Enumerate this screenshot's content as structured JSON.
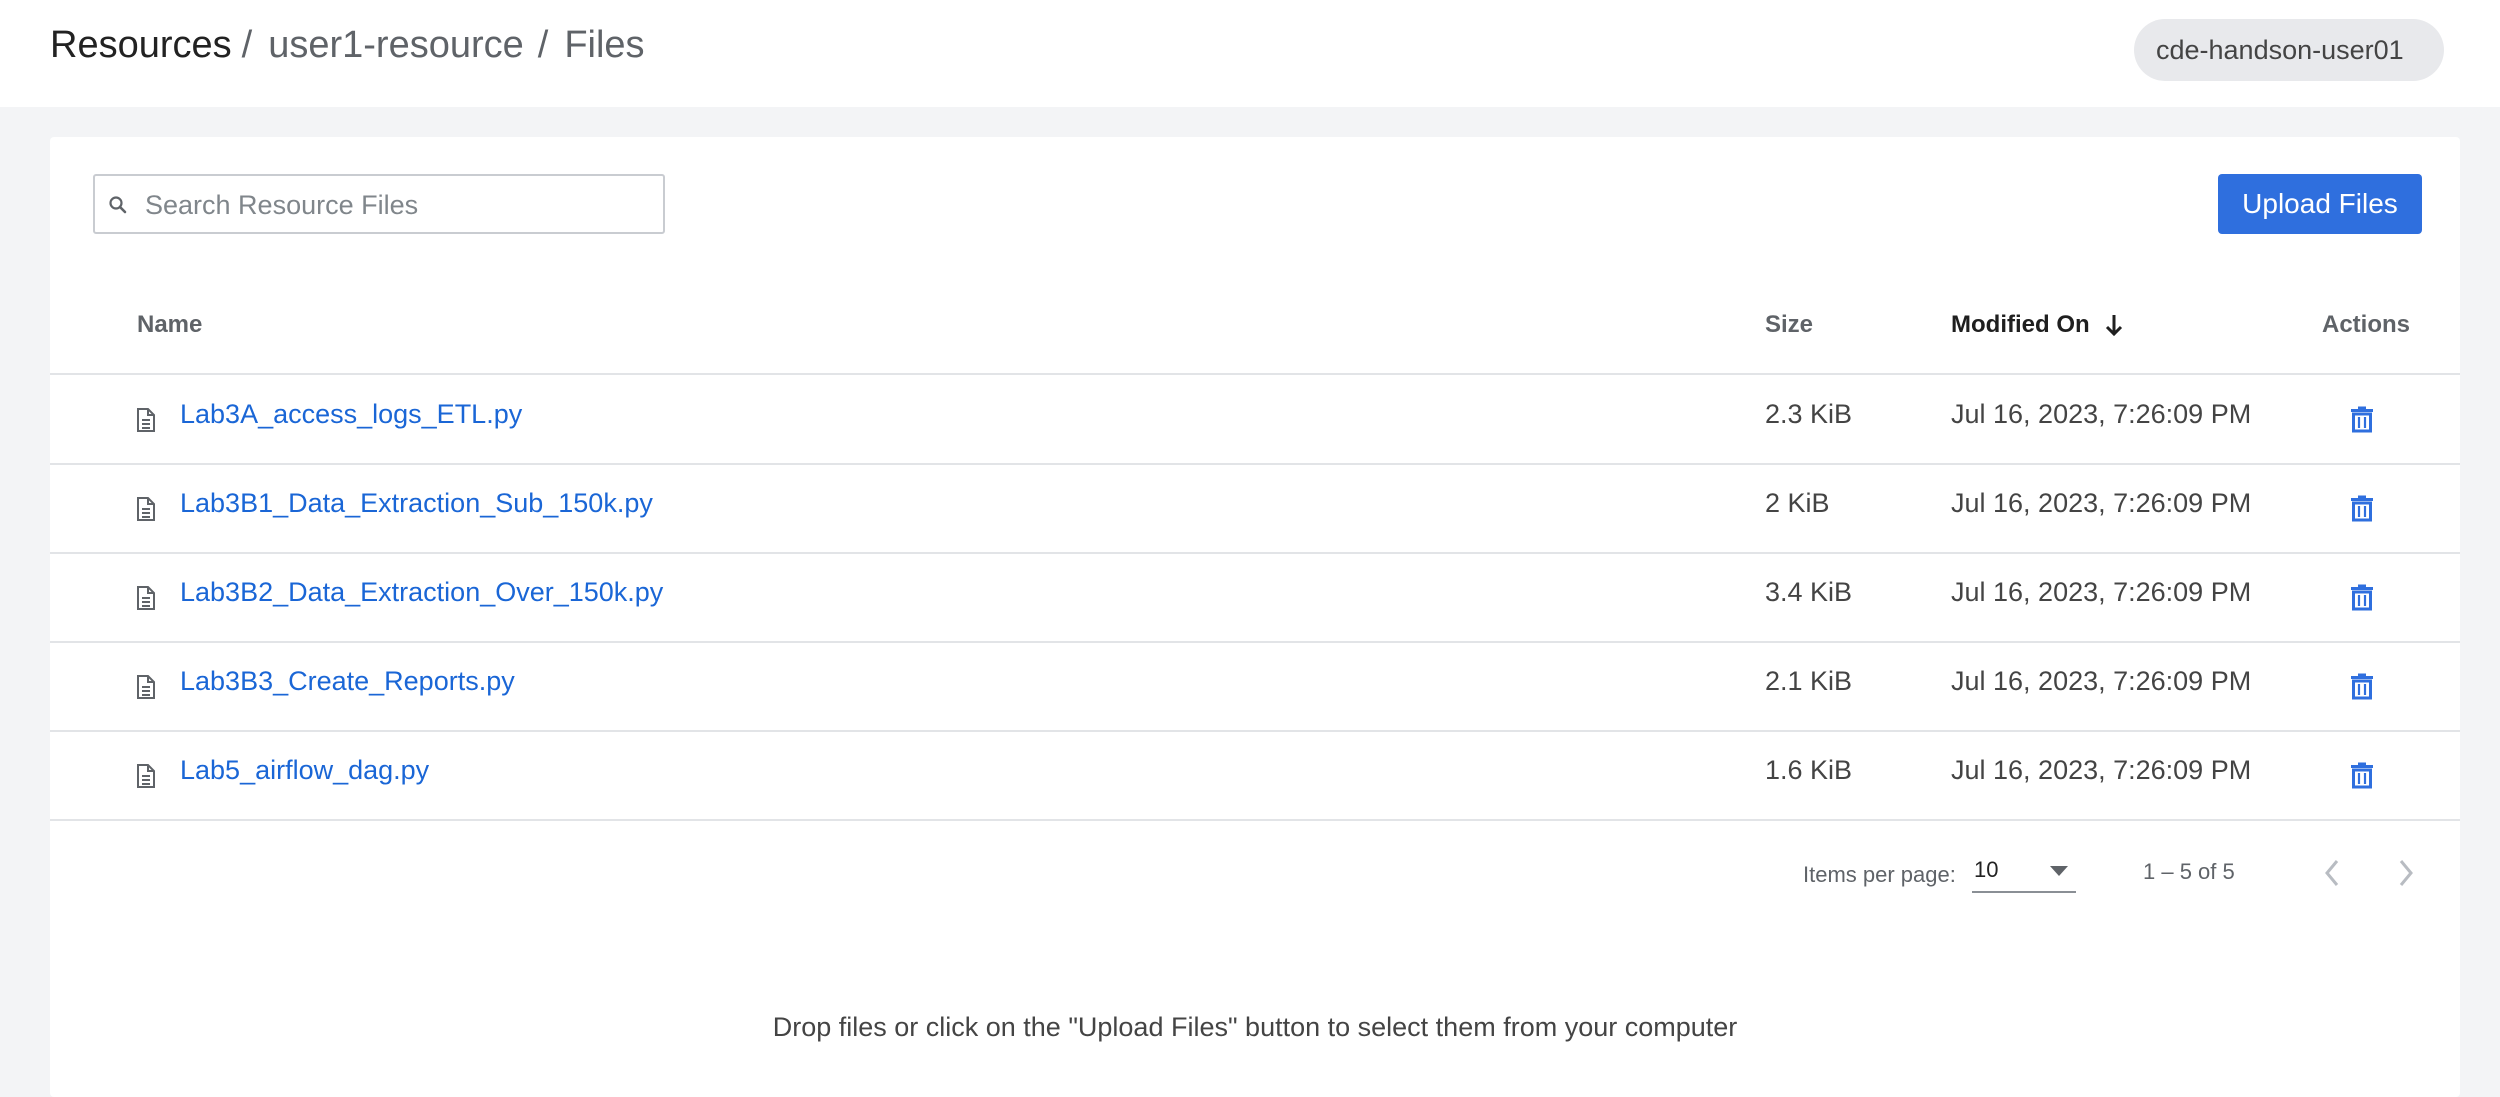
{
  "breadcrumb": {
    "root": "Resources",
    "resource": "user1-resource",
    "current": "Files",
    "separator": "/"
  },
  "user": {
    "name": "cde-handson-user01"
  },
  "search": {
    "placeholder": "Search Resource Files",
    "value": "",
    "icon": "search-icon"
  },
  "toolbar": {
    "upload_label": "Upload Files"
  },
  "table": {
    "columns": {
      "name": "Name",
      "size": "Size",
      "modified": "Modified On",
      "actions": "Actions"
    },
    "sort": {
      "column": "Modified On",
      "direction": "descending",
      "icon": "arrow-down-icon"
    },
    "rows": [
      {
        "name": "Lab3A_access_logs_ETL.py",
        "size": "2.3 KiB",
        "modified": "Jul 16, 2023, 7:26:09 PM"
      },
      {
        "name": "Lab3B1_Data_Extraction_Sub_150k.py",
        "size": "2 KiB",
        "modified": "Jul 16, 2023, 7:26:09 PM"
      },
      {
        "name": "Lab3B2_Data_Extraction_Over_150k.py",
        "size": "3.4 KiB",
        "modified": "Jul 16, 2023, 7:26:09 PM"
      },
      {
        "name": "Lab3B3_Create_Reports.py",
        "size": "2.1 KiB",
        "modified": "Jul 16, 2023, 7:26:09 PM"
      },
      {
        "name": "Lab5_airflow_dag.py",
        "size": "1.6 KiB",
        "modified": "Jul 16, 2023, 7:26:09 PM"
      }
    ]
  },
  "pagination": {
    "items_per_page_label": "Items per page:",
    "items_per_page": "10",
    "range": "1 – 5 of 5"
  },
  "drop_hint": "Drop files or click on the \"Upload Files\" button to select them from your computer",
  "colors": {
    "accent": "#2f6fde",
    "link": "#1a66d6",
    "background": "#f3f4f6"
  }
}
